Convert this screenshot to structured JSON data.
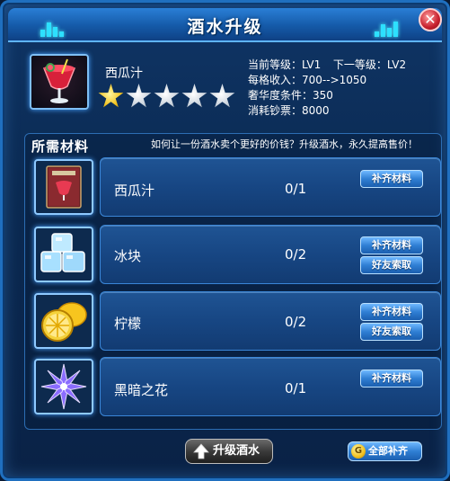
{
  "window": {
    "title": "酒水升级",
    "close_symbol": "✕"
  },
  "drink": {
    "name": "西瓜汁",
    "icon": "watermelon-juice-icon",
    "stars_filled": 1,
    "stars_total": 5,
    "stats": {
      "current_level": "当前等级：LV1",
      "next_level": "下一等级：LV2",
      "income": "每格收入：700-->1050",
      "luxury": "奢华度条件：350",
      "cost": "消耗钞票：8000"
    }
  },
  "materials": {
    "title": "所需材料",
    "hint": "如何让一份酒水卖个更好的价钱？升级酒水，永久提高售价！",
    "items": [
      {
        "name": "西瓜汁",
        "icon": "recipe-book-icon",
        "count": "0/1",
        "buttons": [
          "补齐材料"
        ]
      },
      {
        "name": "冰块",
        "icon": "ice-cubes-icon",
        "count": "0/2",
        "buttons": [
          "补齐材料",
          "好友索取"
        ]
      },
      {
        "name": "柠檬",
        "icon": "lemon-icon",
        "count": "0/2",
        "buttons": [
          "补齐材料",
          "好友索取"
        ]
      },
      {
        "name": "黑暗之花",
        "icon": "dark-flower-icon",
        "count": "0/1",
        "buttons": [
          "补齐材料"
        ]
      }
    ]
  },
  "footer": {
    "upgrade_label": "升级酒水",
    "fill_all_label": "全部补齐",
    "coin_symbol": "G"
  },
  "colors": {
    "panel": "#174683",
    "star_on": "#f2c21d",
    "accent": "#2de0ff"
  }
}
